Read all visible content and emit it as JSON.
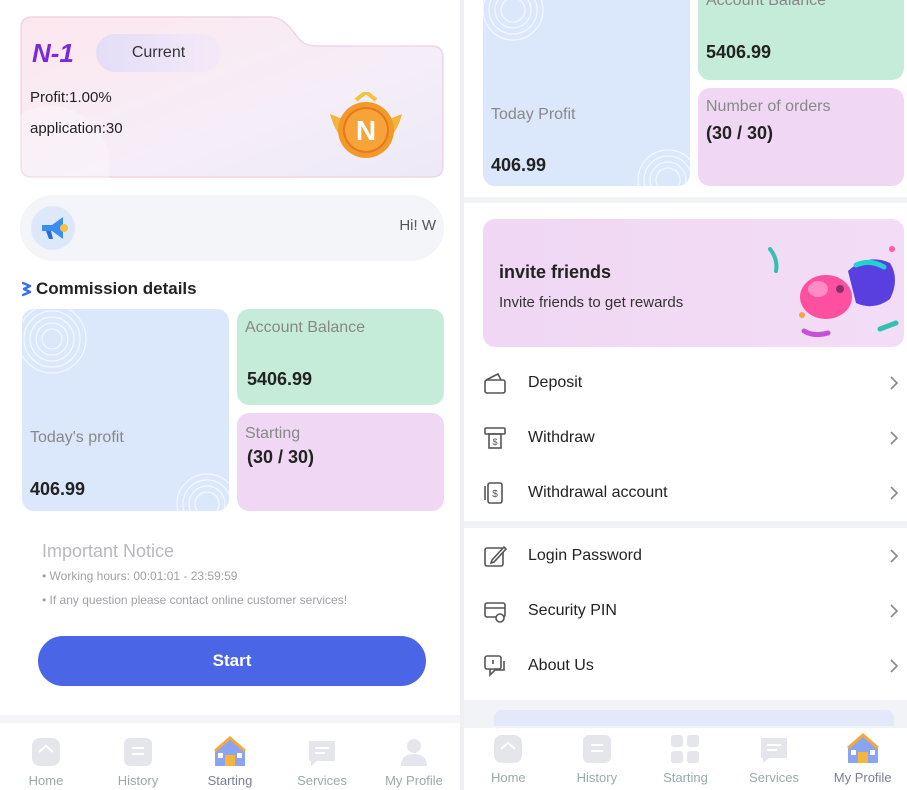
{
  "left": {
    "level": {
      "name": "N-1",
      "status": "Current",
      "profit_line": "Profit:1.00%",
      "application_line": "application:30",
      "badge_letter": "N"
    },
    "announcement": {
      "text": "Hi! W"
    },
    "section_title": "Commission details",
    "tiles": {
      "todays_profit": {
        "label": "Today's profit",
        "value": "406.99"
      },
      "account_balance": {
        "label": "Account Balance",
        "value": "5406.99"
      },
      "starting": {
        "label": "Starting",
        "value": "(30 / 30)"
      }
    },
    "notice": {
      "title": "Important Notice",
      "lines": [
        "• Working hours: 00:01:01 - 23:59:59",
        "• If any question please contact online customer services!"
      ]
    },
    "start_label": "Start",
    "tabs": [
      {
        "label": "Home",
        "icon": "home-icon"
      },
      {
        "label": "History",
        "icon": "history-icon"
      },
      {
        "label": "Starting",
        "icon": "starting-house-icon"
      },
      {
        "label": "Services",
        "icon": "services-icon"
      },
      {
        "label": "My Profile",
        "icon": "profile-icon"
      }
    ]
  },
  "right": {
    "tiles": {
      "today_profit": {
        "label": "Today Profit",
        "value": "406.99"
      },
      "account_balance": {
        "label": "Account Balance",
        "value": "5406.99"
      },
      "orders": {
        "label": "Number of orders",
        "value": "(30 / 30)"
      }
    },
    "invite": {
      "title": "invite friends",
      "subtitle": "Invite friends to get rewards"
    },
    "menu": [
      {
        "label": "Deposit",
        "icon": "wallet-icon"
      },
      {
        "label": "Withdraw",
        "icon": "withdraw-icon"
      },
      {
        "label": "Withdrawal account",
        "icon": "withdrawal-account-icon"
      },
      {
        "label": "Login Password",
        "icon": "edit-password-icon"
      },
      {
        "label": "Security PIN",
        "icon": "security-card-icon"
      },
      {
        "label": "About Us",
        "icon": "about-chat-icon"
      }
    ],
    "tabs": [
      {
        "label": "Home",
        "icon": "home-icon"
      },
      {
        "label": "History",
        "icon": "history-icon"
      },
      {
        "label": "Starting",
        "icon": "starting-icon"
      },
      {
        "label": "Services",
        "icon": "services-icon"
      },
      {
        "label": "My Profile",
        "icon": "profile-house-icon"
      }
    ]
  },
  "colors": {
    "accent_blue": "#4a66e6",
    "level_purple": "#7a2ad8",
    "tile_blue": "#dbe7fb",
    "tile_green": "#c5ecd9",
    "tile_pink": "#f0d8f4"
  }
}
